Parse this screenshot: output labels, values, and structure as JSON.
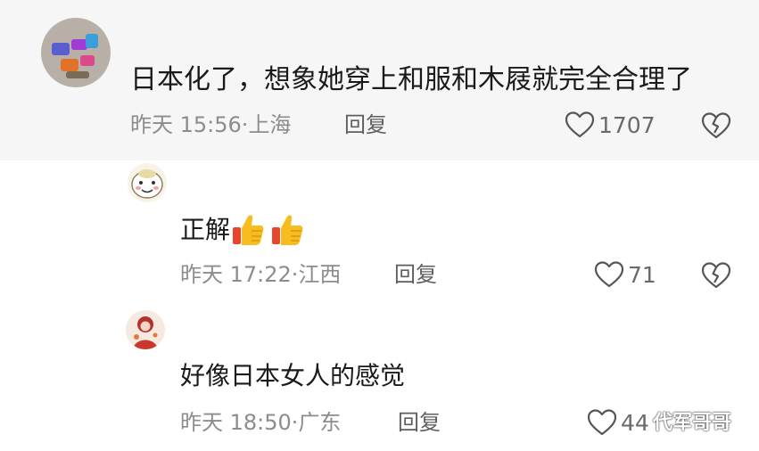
{
  "comments": [
    {
      "text": "日本化了，想象她穿上和服和木屐就完全合理了",
      "time": "昨天 15:56",
      "location": "上海",
      "reply_label": "回复",
      "likes": "1707",
      "avatar_icon": "colorful-items-photo-avatar"
    },
    {
      "text": "正解",
      "emojis": [
        "thumbs-up-icon",
        "thumbs-up-icon"
      ],
      "time": "昨天 17:22",
      "location": "江西",
      "reply_label": "回复",
      "likes": "71",
      "avatar_icon": "cartoon-face-avatar"
    },
    {
      "text": "好像日本女人的感觉",
      "time": "昨天 18:50",
      "location": "广东",
      "reply_label": "回复",
      "likes": "44",
      "avatar_icon": "red-illustration-avatar"
    }
  ],
  "separator": "·",
  "watermark": "代军哥哥",
  "colors": {
    "meta": "#8c8c8c",
    "top_bg": "#f6f6f6",
    "thumb": "#f5b81f"
  }
}
